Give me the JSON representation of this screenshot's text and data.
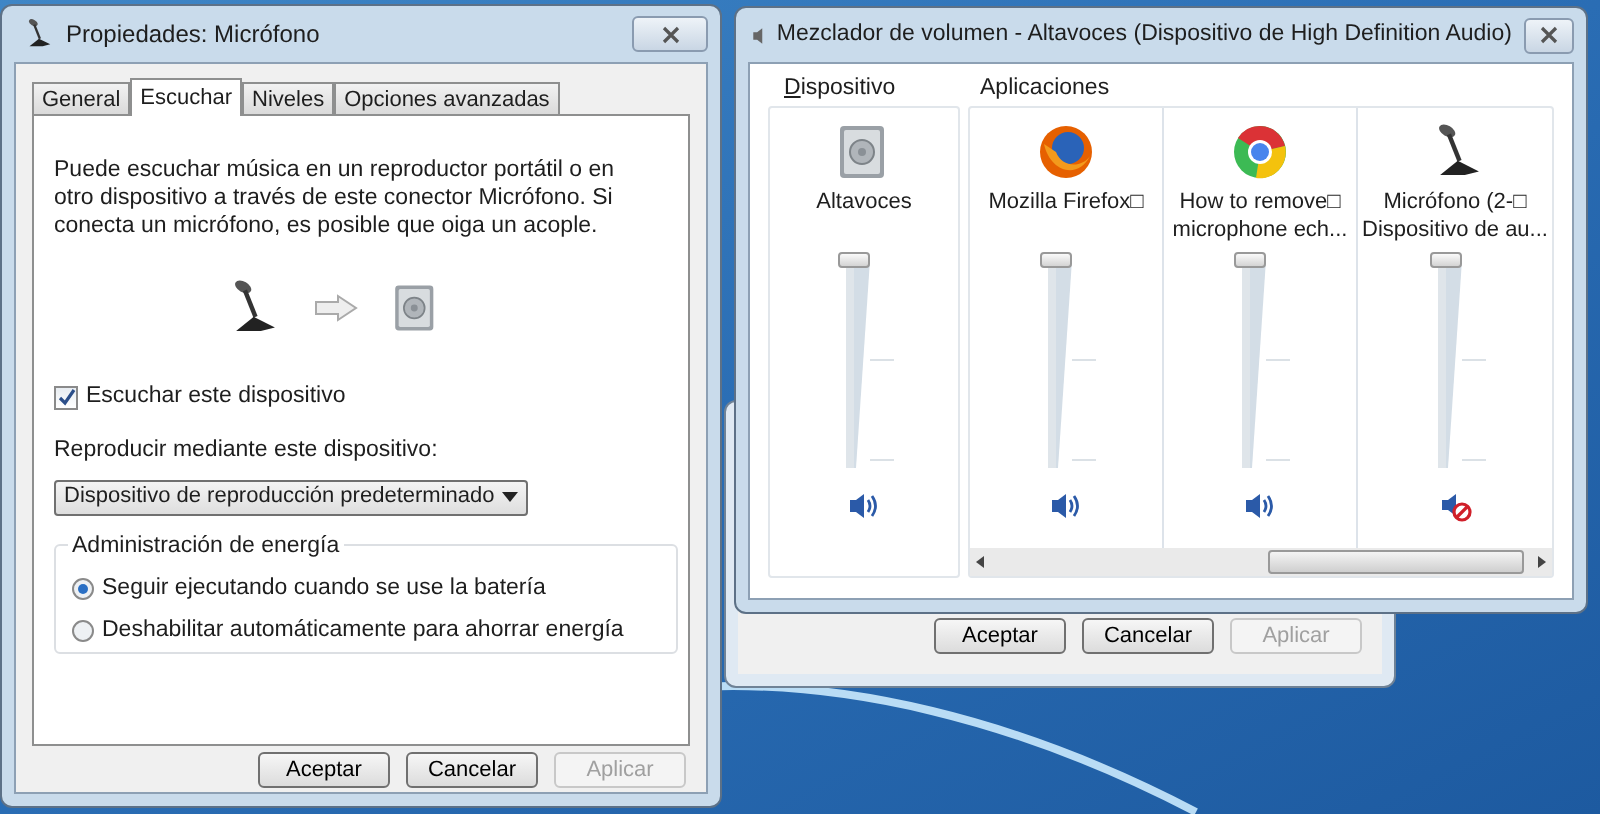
{
  "properties_window": {
    "title": "Propiedades: Micrófono",
    "tabs": [
      {
        "label": "General",
        "selected": false
      },
      {
        "label": "Escuchar",
        "selected": true
      },
      {
        "label": "Niveles",
        "selected": false
      },
      {
        "label": "Opciones avanzadas",
        "selected": false
      }
    ],
    "description": "Puede escuchar música en un reproductor portátil o en otro dispositivo a través de este conector Micrófono. Si conecta un micrófono, es posible que oiga un acople.",
    "listen_checkbox": {
      "label": "Escuchar este dispositivo",
      "checked": true
    },
    "playback_label": "Reproducir mediante este dispositivo:",
    "playback_dropdown": {
      "value": "Dispositivo de reproducción predeterminado"
    },
    "power_group": {
      "title": "Administración de energía",
      "options": [
        {
          "label": "Seguir ejecutando cuando se use la batería",
          "selected": true
        },
        {
          "label": "Deshabilitar automáticamente para ahorrar energía",
          "selected": false
        }
      ]
    },
    "buttons": [
      {
        "label": "Aceptar",
        "disabled": false
      },
      {
        "label": "Cancelar",
        "disabled": false
      },
      {
        "label": "Aplicar",
        "disabled": true
      }
    ]
  },
  "mixer_window": {
    "title": "Mezclador de volumen - Altavoces (Dispositivo de High Definition Audio)",
    "device_group": {
      "title": "Dispositivo",
      "channels": [
        {
          "kind": "speaker",
          "name": "Altavoces",
          "level": 1,
          "muted": false
        }
      ]
    },
    "apps_group": {
      "title": "Aplicaciones",
      "channels": [
        {
          "kind": "firefox",
          "name": "Mozilla Firefox□",
          "level": 1,
          "muted": false
        },
        {
          "kind": "chrome",
          "name": "How to remove□\nmicrophone ech...",
          "level": 1,
          "muted": false
        },
        {
          "kind": "microphone",
          "name": "Micrófono (2-□\nDispositivo de au...",
          "level": 1,
          "muted": true
        }
      ]
    }
  },
  "back_window": {
    "buttons": [
      {
        "label": "Aceptar",
        "disabled": false
      },
      {
        "label": "Cancelar",
        "disabled": false
      },
      {
        "label": "Aplicar",
        "disabled": true
      }
    ]
  }
}
